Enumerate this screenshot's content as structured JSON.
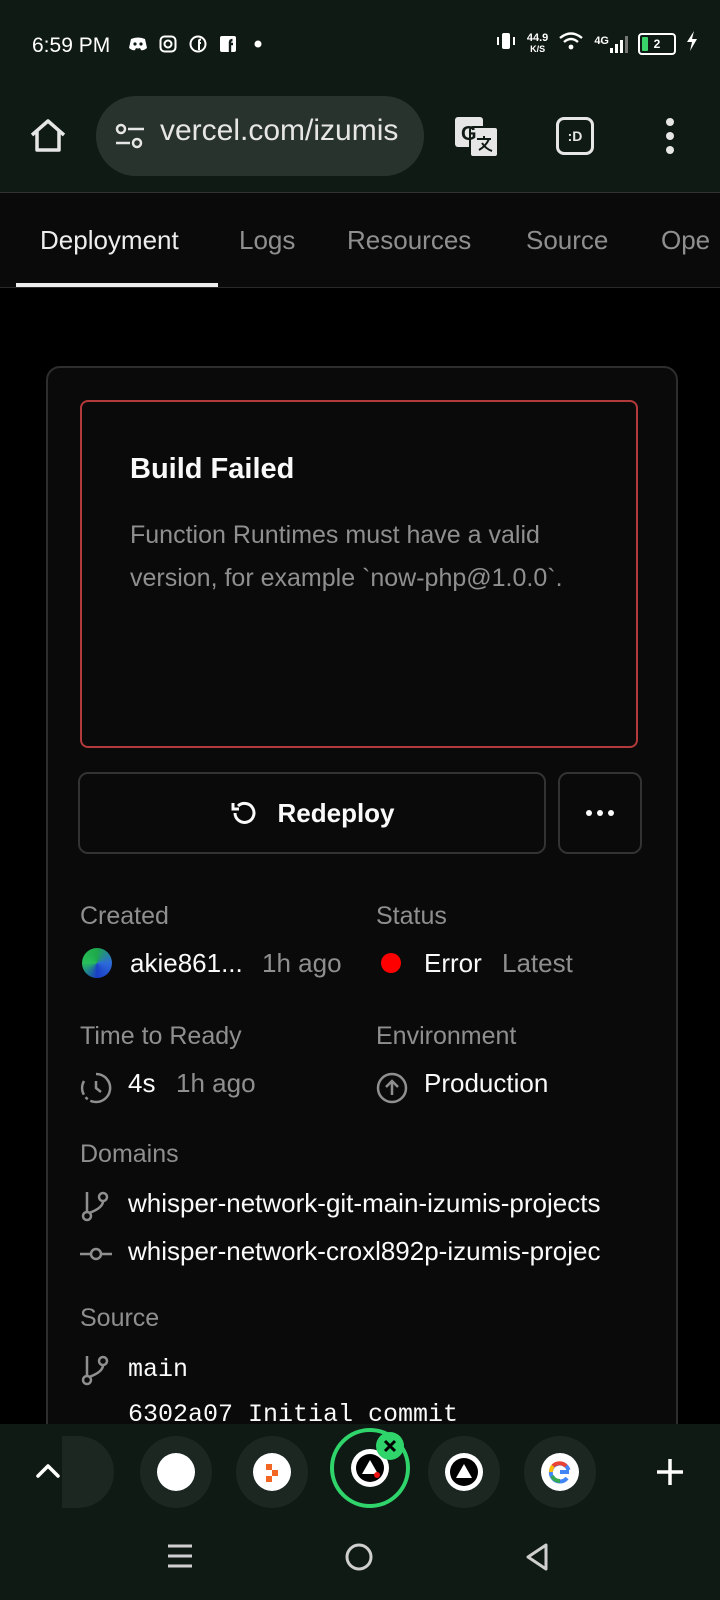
{
  "status_bar": {
    "time": "6:59 PM",
    "net_speed_value": "44.9",
    "net_speed_unit": "K/S",
    "network_type": "4G",
    "battery_level": "2"
  },
  "browser": {
    "url": "vercel.com/izumis",
    "tab_switcher_label": ":D"
  },
  "tabs": [
    {
      "label": "Deployment",
      "active": true
    },
    {
      "label": "Logs"
    },
    {
      "label": "Resources"
    },
    {
      "label": "Source"
    },
    {
      "label": "Ope"
    }
  ],
  "error": {
    "title": "Build Failed",
    "message": "Function Runtimes must have a valid version, for example `now-php@1.0.0`."
  },
  "actions": {
    "redeploy_label": "Redeploy"
  },
  "details": {
    "created_label": "Created",
    "created_user": "akie861...",
    "created_time": "1h ago",
    "status_label": "Status",
    "status_value": "Error",
    "status_tag": "Latest",
    "ready_label": "Time to Ready",
    "ready_value": "4s",
    "ready_time": "1h ago",
    "env_label": "Environment",
    "env_value": "Production",
    "domains_label": "Domains",
    "domains": [
      "whisper-network-git-main-izumis-projects",
      "whisper-network-croxl892p-izumis-projec"
    ],
    "source_label": "Source",
    "source_branch": "main",
    "source_commit": "6302a07 Initial commit"
  },
  "colors": {
    "error_red": "#ff0000",
    "error_border": "#b33a3a",
    "active_tab_ring": "#2fd46a"
  }
}
